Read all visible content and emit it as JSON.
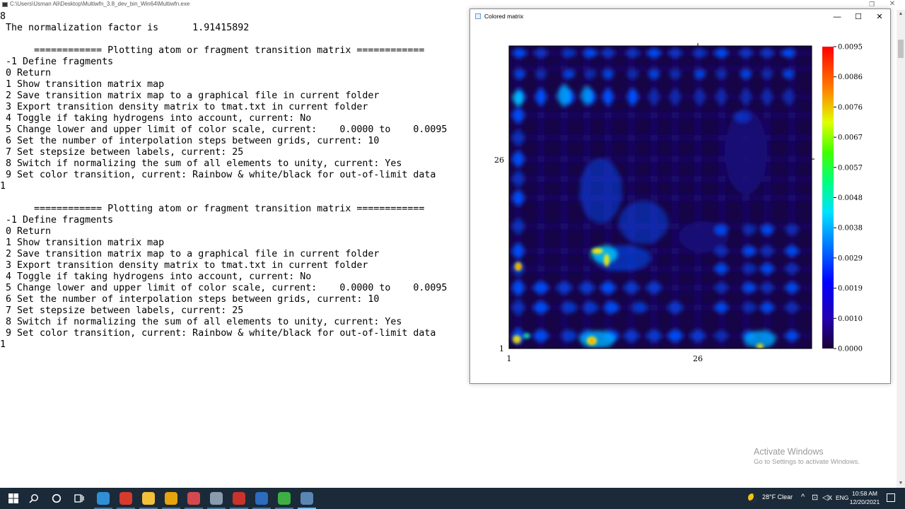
{
  "console": {
    "title": "C:\\Users\\Usman Ali\\Desktop\\Multiwfn_3.8_dev_bin_Win64\\Multiwfn.exe",
    "lines": [
      "8",
      " The normalization factor is      1.91415892",
      "",
      "      ============ Plotting atom or fragment transition matrix ============",
      " -1 Define fragments",
      " 0 Return",
      " 1 Show transition matrix map",
      " 2 Save transition matrix map to a graphical file in current folder",
      " 3 Export transition density matrix to tmat.txt in current folder",
      " 4 Toggle if taking hydrogens into account, current: No",
      " 5 Change lower and upper limit of color scale, current:    0.0000 to    0.0095",
      " 6 Set the number of interpolation steps between grids, current: 10",
      " 7 Set stepsize between labels, current: 25",
      " 8 Switch if normalizing the sum of all elements to unity, current: Yes",
      " 9 Set color transition, current: Rainbow & white/black for out-of-limit data",
      "1",
      "",
      "      ============ Plotting atom or fragment transition matrix ============",
      " -1 Define fragments",
      " 0 Return",
      " 1 Show transition matrix map",
      " 2 Save transition matrix map to a graphical file in current folder",
      " 3 Export transition density matrix to tmat.txt in current folder",
      " 4 Toggle if taking hydrogens into account, current: No",
      " 5 Change lower and upper limit of color scale, current:    0.0000 to    0.0095",
      " 6 Set the number of interpolation steps between grids, current: 10",
      " 7 Set stepsize between labels, current: 25",
      " 8 Switch if normalizing the sum of all elements to unity, current: Yes",
      " 9 Set color transition, current: Rainbow & white/black for out-of-limit data",
      "1"
    ]
  },
  "matrix_window": {
    "title": "Colored matrix",
    "minimize_glyph": "—",
    "maximize_glyph": "☐",
    "close_glyph": "✕",
    "x_ticks": [
      "1",
      "26"
    ],
    "y_ticks": [
      "1",
      "26"
    ],
    "colorbar_ticks": [
      "0.0095",
      "0.0086",
      "0.0076",
      "0.0067",
      "0.0057",
      "0.0048",
      "0.0038",
      "0.0029",
      "0.0019",
      "0.0010",
      "0.0000"
    ],
    "colors": {
      "background": "#170447",
      "low": "#1a0a78",
      "mid": "#0050ff",
      "high": "#ffee00",
      "max": "#ff1a00"
    }
  },
  "watermark": {
    "title": "Activate Windows",
    "subtitle": "Go to Settings to activate Windows."
  },
  "taskbar": {
    "start_icon": "windows-start-icon",
    "search_icon": "search-icon",
    "cortana_icon": "cortana-circle-icon",
    "taskview_icon": "task-view-icon",
    "apps": [
      {
        "name": "edge-icon",
        "color": "#2f8fd6"
      },
      {
        "name": "app-red-icon",
        "color": "#d83a2e"
      },
      {
        "name": "file-explorer-icon",
        "color": "#f3c03a"
      },
      {
        "name": "chrome-icon",
        "color": "#e6a40d"
      },
      {
        "name": "app-cloud-icon",
        "color": "#d24a50"
      },
      {
        "name": "app-tool-icon",
        "color": "#8a9bb0"
      },
      {
        "name": "acrobat-icon",
        "color": "#c9332c"
      },
      {
        "name": "en-app-icon",
        "color": "#2b6cbf"
      },
      {
        "name": "wechat-icon",
        "color": "#3cb043"
      },
      {
        "name": "multiwfn-icon",
        "color": "#5a86b4"
      }
    ],
    "weather": "28°F  Clear",
    "language": "ENG",
    "time": "10:58 AM",
    "date": "12/20/2021",
    "chevron_glyph": "^",
    "network_glyph": "⊡",
    "volume_glyph": "◁x"
  }
}
